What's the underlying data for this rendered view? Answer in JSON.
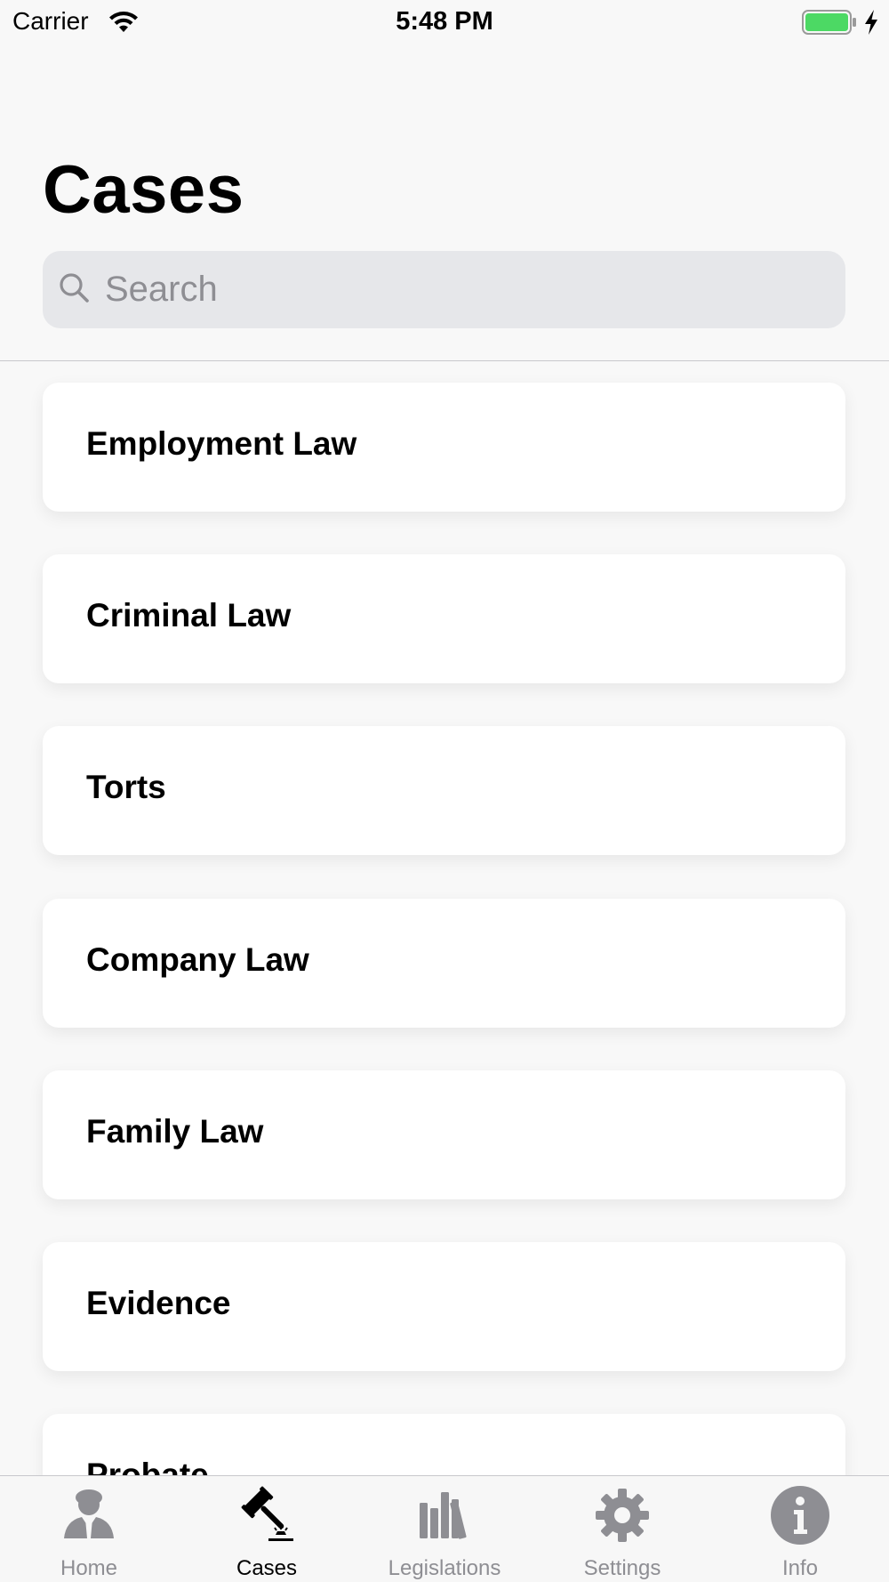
{
  "status_bar": {
    "carrier": "Carrier",
    "time": "5:48 PM",
    "battery_color": "#4cd964"
  },
  "header": {
    "title": "Cases",
    "search": {
      "placeholder": "Search",
      "value": ""
    }
  },
  "cases": [
    {
      "label": "Employment Law"
    },
    {
      "label": "Criminal Law"
    },
    {
      "label": "Torts"
    },
    {
      "label": "Company Law"
    },
    {
      "label": "Family Law"
    },
    {
      "label": "Evidence"
    },
    {
      "label": "Probate"
    }
  ],
  "tab_bar": {
    "active_tab": "Cases",
    "active_color": "#000000",
    "inactive_color": "#8e8e93",
    "tabs": [
      {
        "label": "Home",
        "icon": "lawyer-icon"
      },
      {
        "label": "Cases",
        "icon": "gavel-icon"
      },
      {
        "label": "Legislations",
        "icon": "books-icon"
      },
      {
        "label": "Settings",
        "icon": "gear-icon"
      },
      {
        "label": "Info",
        "icon": "info-icon"
      }
    ]
  }
}
